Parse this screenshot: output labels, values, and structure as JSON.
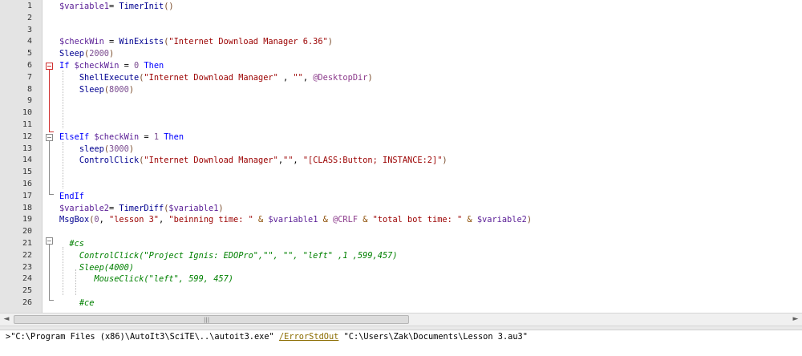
{
  "editor": {
    "lines": [
      {
        "n": "1",
        "t": [
          [
            "var",
            "$variable1"
          ],
          [
            "",
            "= "
          ],
          [
            "fn",
            "TimerInit"
          ],
          [
            "punc",
            "()"
          ]
        ]
      },
      {
        "n": "2",
        "t": []
      },
      {
        "n": "3",
        "t": []
      },
      {
        "n": "4",
        "t": [
          [
            "var",
            "$checkWin"
          ],
          [
            "",
            " = "
          ],
          [
            "fn",
            "WinExists"
          ],
          [
            "punc",
            "("
          ],
          [
            "str",
            "\"Internet Download Manager 6.36\""
          ],
          [
            "punc",
            ")"
          ]
        ]
      },
      {
        "n": "5",
        "t": [
          [
            "fn",
            "Sleep"
          ],
          [
            "punc",
            "("
          ],
          [
            "num",
            "2000"
          ],
          [
            "punc",
            ")"
          ]
        ]
      },
      {
        "n": "6",
        "t": [
          [
            "k",
            "If"
          ],
          [
            "",
            " "
          ],
          [
            "var",
            "$checkWin"
          ],
          [
            "",
            " = "
          ],
          [
            "num",
            "0"
          ],
          [
            "",
            " "
          ],
          [
            "k",
            "Then"
          ]
        ]
      },
      {
        "n": "7",
        "t": [
          [
            "",
            "    "
          ],
          [
            "fn",
            "ShellExecute"
          ],
          [
            "punc",
            "("
          ],
          [
            "str",
            "\"Internet Download Manager\""
          ],
          [
            "",
            " , "
          ],
          [
            "str",
            "\"\""
          ],
          [
            "",
            ", "
          ],
          [
            "mac",
            "@DesktopDir"
          ],
          [
            "punc",
            ")"
          ]
        ]
      },
      {
        "n": "8",
        "t": [
          [
            "",
            "    "
          ],
          [
            "fn",
            "Sleep"
          ],
          [
            "punc",
            "("
          ],
          [
            "num",
            "8000"
          ],
          [
            "punc",
            ")"
          ]
        ]
      },
      {
        "n": "9",
        "t": []
      },
      {
        "n": "10",
        "t": []
      },
      {
        "n": "11",
        "t": []
      },
      {
        "n": "12",
        "t": [
          [
            "k",
            "ElseIf"
          ],
          [
            "",
            " "
          ],
          [
            "var",
            "$checkWin"
          ],
          [
            "",
            " = "
          ],
          [
            "num",
            "1"
          ],
          [
            "",
            " "
          ],
          [
            "k",
            "Then"
          ]
        ]
      },
      {
        "n": "13",
        "t": [
          [
            "",
            "    "
          ],
          [
            "fn",
            "sleep"
          ],
          [
            "punc",
            "("
          ],
          [
            "num",
            "3000"
          ],
          [
            "punc",
            ")"
          ]
        ]
      },
      {
        "n": "14",
        "t": [
          [
            "",
            "    "
          ],
          [
            "fn",
            "ControlClick"
          ],
          [
            "punc",
            "("
          ],
          [
            "str",
            "\"Internet Download Manager\""
          ],
          [
            "",
            ","
          ],
          [
            "str",
            "\"\""
          ],
          [
            "",
            ", "
          ],
          [
            "str",
            "\"[CLASS:Button; INSTANCE:2]\""
          ],
          [
            "punc",
            ")"
          ]
        ]
      },
      {
        "n": "15",
        "t": []
      },
      {
        "n": "16",
        "t": []
      },
      {
        "n": "17",
        "t": [
          [
            "k",
            "EndIf"
          ]
        ]
      },
      {
        "n": "18",
        "t": [
          [
            "var",
            "$variable2"
          ],
          [
            "",
            "= "
          ],
          [
            "fn",
            "TimerDiff"
          ],
          [
            "punc",
            "("
          ],
          [
            "var",
            "$variable1"
          ],
          [
            "punc",
            ")"
          ]
        ]
      },
      {
        "n": "19",
        "t": [
          [
            "fn",
            "MsgBox"
          ],
          [
            "punc",
            "("
          ],
          [
            "num",
            "0"
          ],
          [
            "",
            ", "
          ],
          [
            "str",
            "\"lesson 3\""
          ],
          [
            "",
            ", "
          ],
          [
            "str",
            "\"beinning time: \""
          ],
          [
            "op",
            " & "
          ],
          [
            "var",
            "$variable1"
          ],
          [
            "op",
            " & "
          ],
          [
            "mac",
            "@CRLF"
          ],
          [
            "op",
            " & "
          ],
          [
            "str",
            "\"total bot time: \""
          ],
          [
            "op",
            " & "
          ],
          [
            "var",
            "$variable2"
          ],
          [
            "punc",
            ")"
          ]
        ]
      },
      {
        "n": "20",
        "t": []
      },
      {
        "n": "21",
        "t": [
          [
            "",
            "  "
          ],
          [
            "cmt",
            "#cs"
          ]
        ]
      },
      {
        "n": "22",
        "t": [
          [
            "",
            "    "
          ],
          [
            "cmt",
            "ControlClick(\"Project Ignis: EDOPro\",\"\", \"\", \"left\" ,1 ,599,457)"
          ]
        ]
      },
      {
        "n": "23",
        "t": [
          [
            "",
            "    "
          ],
          [
            "cmt",
            "Sleep(4000)"
          ]
        ]
      },
      {
        "n": "24",
        "t": [
          [
            "",
            "       "
          ],
          [
            "cmt",
            "MouseClick(\"left\", 599, 457)"
          ]
        ]
      },
      {
        "n": "25",
        "t": []
      },
      {
        "n": "26",
        "t": [
          [
            "",
            "    "
          ],
          [
            "cmt",
            "#ce"
          ]
        ]
      }
    ]
  },
  "scrollbar": {
    "left_arrow": "◄",
    "right_arrow": "►",
    "grip": "|||"
  },
  "output": {
    "part1": ">\"C:\\Program Files (x86)\\AutoIt3\\SciTE\\..\\autoit3.exe\" ",
    "part2": "/ErrorStdOut",
    "part3": " \"C:\\Users\\Zak\\Documents\\Lesson 3.au3\""
  },
  "colors": {
    "keyword": "#0000ff",
    "function": "#000090",
    "variable": "#5a1e96",
    "string": "#9b0000",
    "comment": "#008000",
    "fold_marker": "#d03030"
  }
}
